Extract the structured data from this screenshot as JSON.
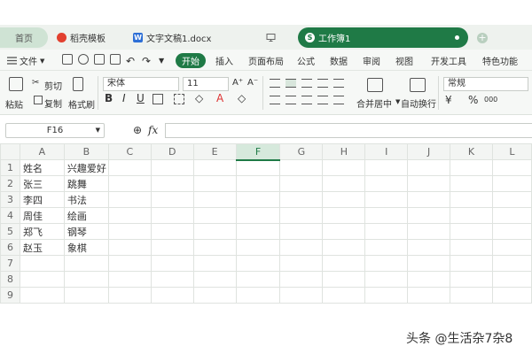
{
  "tabs": {
    "home": "首页",
    "templates": "稻壳模板",
    "doc": "文字文稿1.docx",
    "workbook": "工作簿1",
    "word_icon_letter": "W",
    "sheet_icon_letter": "S",
    "add": "+"
  },
  "menu": {
    "file": "文件",
    "items": [
      "开始",
      "插入",
      "页面布局",
      "公式",
      "数据",
      "审阅",
      "视图",
      "开发工具",
      "特色功能"
    ]
  },
  "ribbon": {
    "paste": "粘贴",
    "cut": "剪切",
    "copy": "复制",
    "format_painter": "格式刷",
    "font_name": "宋体",
    "font_size": "11",
    "grow_font": "A⁺",
    "shrink_font": "A⁻",
    "bold": "B",
    "italic": "I",
    "underline": "U",
    "strike": "U",
    "merge_center": "合并居中",
    "wrap_text": "自动换行",
    "number_format": "常规",
    "currency": "¥",
    "percent": "%",
    "thousands": "000"
  },
  "formula_bar": {
    "cell_ref": "F16",
    "fx": "fx",
    "value": ""
  },
  "grid": {
    "columns": [
      "A",
      "B",
      "C",
      "D",
      "E",
      "F",
      "G",
      "H",
      "I",
      "J",
      "K",
      "L"
    ],
    "selected_column": "F",
    "rows": [
      {
        "num": "1",
        "a": "姓名",
        "b": "兴趣爱好"
      },
      {
        "num": "2",
        "a": "张三",
        "b": "跳舞"
      },
      {
        "num": "3",
        "a": "李四",
        "b": "书法"
      },
      {
        "num": "4",
        "a": "周佳",
        "b": "绘画"
      },
      {
        "num": "5",
        "a": "郑飞",
        "b": "钢琴"
      },
      {
        "num": "6",
        "a": "赵玉",
        "b": "象棋"
      },
      {
        "num": "7",
        "a": "",
        "b": ""
      },
      {
        "num": "8",
        "a": "",
        "b": ""
      },
      {
        "num": "9",
        "a": "",
        "b": ""
      }
    ]
  },
  "watermark": "头条 @生活杂7杂8",
  "colors": {
    "accent": "#1f7a46",
    "tabbar_bg": "#eef2ee",
    "grid_line": "#dfe3df"
  }
}
